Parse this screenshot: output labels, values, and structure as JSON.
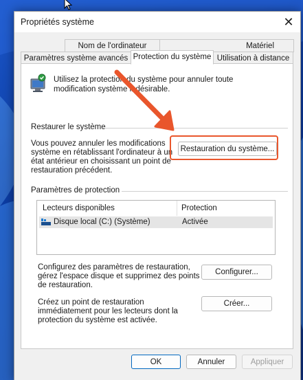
{
  "window": {
    "title": "Propriétés système",
    "close_glyph": "✕"
  },
  "tabs": {
    "row1": [
      "Nom de l'ordinateur",
      "Matériel"
    ],
    "row2": [
      "Paramètres système avancés",
      "Protection du système",
      "Utilisation à distance"
    ],
    "active": "Protection du système"
  },
  "intro": {
    "text": "Utilisez la protection du système pour annuler toute modification système indésirable.",
    "icon": "computer-shield-icon"
  },
  "restore": {
    "group_label": "Restaurer le système",
    "description": "Vous pouvez annuler les modifications système en rétablissant l'ordinateur à un état antérieur en choisissant un point de restauration précédent.",
    "button_label": "Restauration du système..."
  },
  "protection": {
    "group_label": "Paramètres de protection",
    "columns": [
      "Lecteurs disponibles",
      "Protection"
    ],
    "rows": [
      {
        "drive": "Disque local (C:) (Système)",
        "status": "Activée"
      }
    ]
  },
  "configure": {
    "description": "Configurez des paramètres de restauration, gérez l'espace disque et supprimez des points de restauration.",
    "button_label": "Configurer..."
  },
  "create": {
    "description": "Créez un point de restauration immédiatement pour les lecteurs dont la protection du système est activée.",
    "button_label": "Créer..."
  },
  "footer": {
    "ok_label": "OK",
    "cancel_label": "Annuler",
    "apply_label": "Appliquer"
  },
  "annotation": {
    "color": "#e9562c"
  }
}
